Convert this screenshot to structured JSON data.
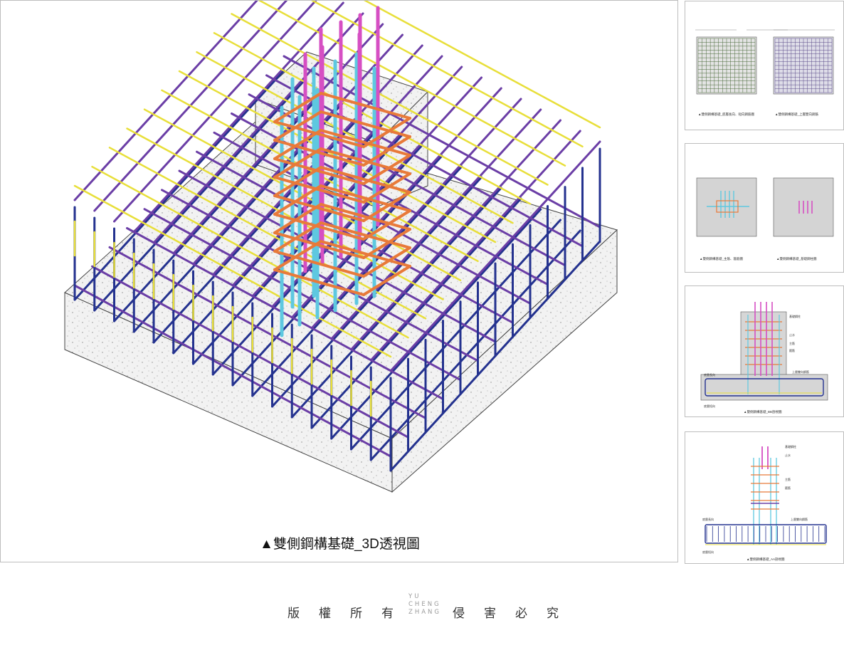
{
  "main": {
    "caption": "▲雙側鋼構基礎_3D透視圖",
    "colors": {
      "column_main_bar": "#d64fc3",
      "column_bar": "#5ec8e0",
      "stirrup": "#e87a3a",
      "bottom_bar": "#24328f",
      "top_bar": "#6b3ea6",
      "mid_bar": "#e8df3a"
    }
  },
  "thumbnails": [
    {
      "captions": [
        "▲雙側鋼構基礎_底層長向、短向鋼筋圖",
        "▲雙側鋼構基礎_上層雙向鋼筋"
      ]
    },
    {
      "captions": [
        "▲雙側鋼構基礎_主筋、箍筋圖",
        "▲雙側鋼構基礎_基礎鋼柱圖"
      ]
    },
    {
      "captions": [
        "▲雙側鋼構基礎_BB剖視圖"
      ],
      "labels": [
        "基礎鋼柱",
        "止水",
        "箍筋",
        "主筋",
        "上層雙向鋼筋",
        "底層長向",
        "底層短向"
      ]
    },
    {
      "captions": [
        "▲雙側鋼構基礎_AA剖視圖"
      ],
      "labels": [
        "基礎鋼柱",
        "止水",
        "箍筋",
        "主筋",
        "上層雙向鋼筋",
        "底層長向",
        "底層短向"
      ]
    }
  ],
  "footer": {
    "left_chars": [
      "版",
      "權",
      "所",
      "有"
    ],
    "right_chars": [
      "侵",
      "害",
      "必",
      "究"
    ],
    "logo_lines": [
      "YU",
      "CHENG",
      "ZHANG"
    ]
  }
}
